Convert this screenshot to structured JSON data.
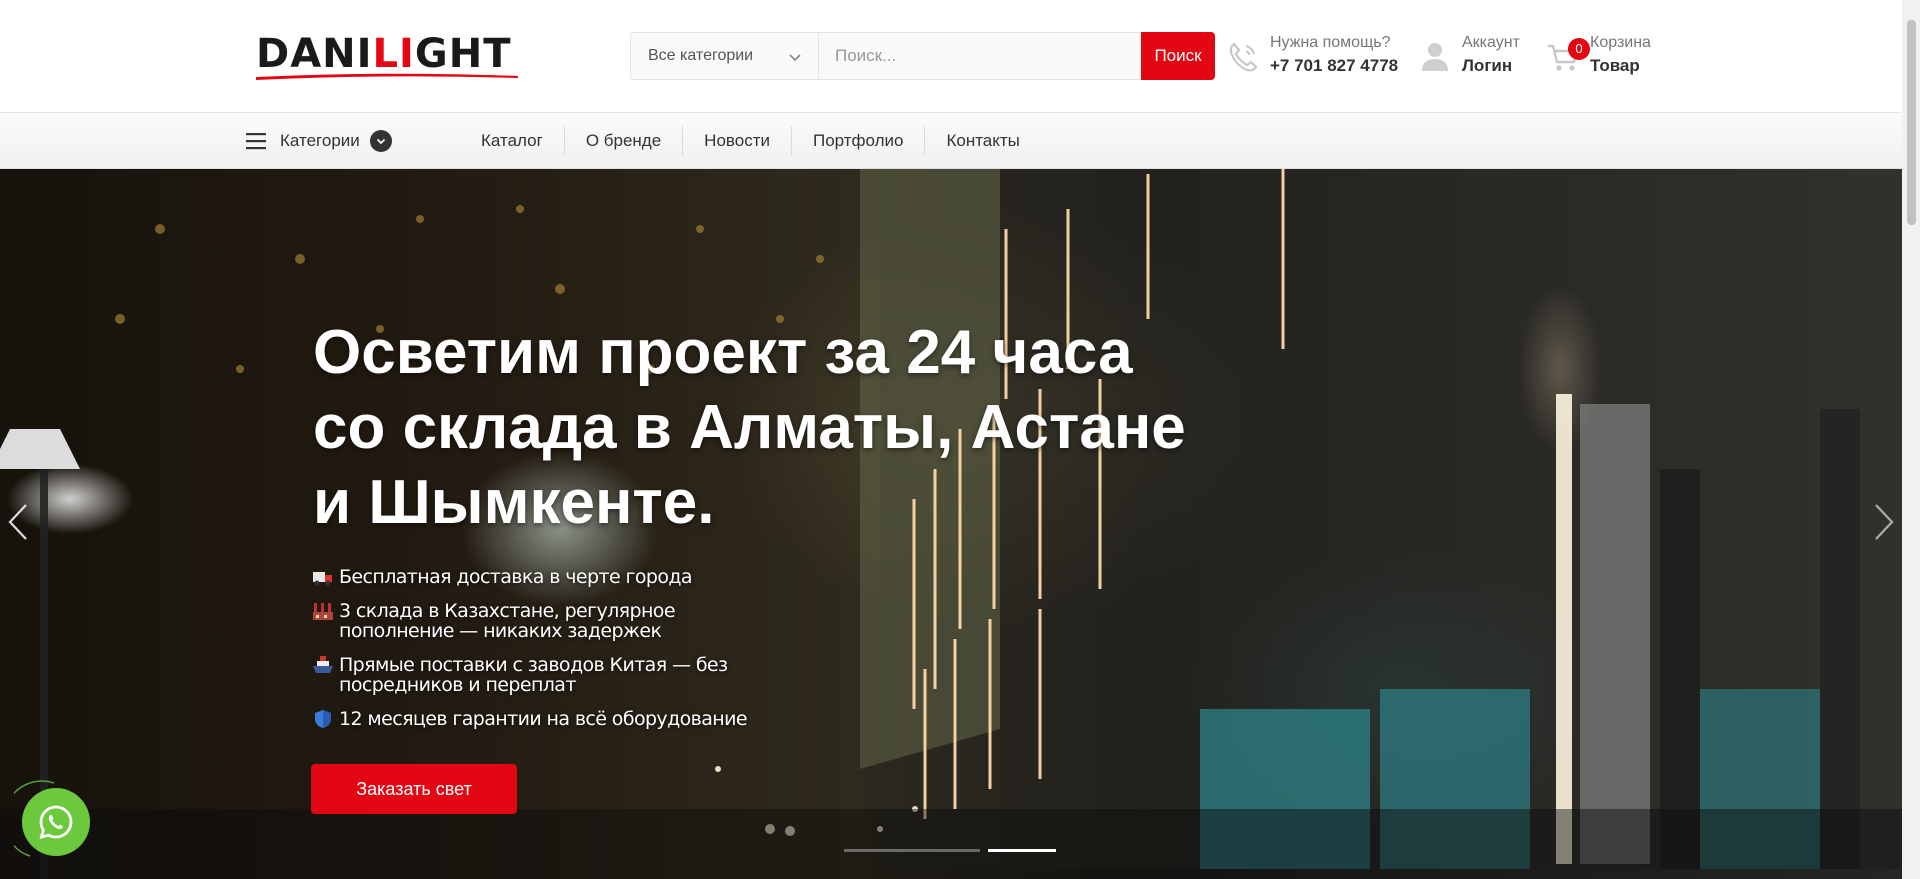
{
  "brand": {
    "logo_part1": "DANI",
    "logo_part2": "LI",
    "logo_part3": "GHT",
    "accent_color": "#e30613"
  },
  "search": {
    "category_label": "Все категории",
    "placeholder": "Поиск...",
    "button_label": "Поиск"
  },
  "help": {
    "label": "Нужна помощь?",
    "phone": "+7 701 827 4778",
    "icon": "phone-icon"
  },
  "account": {
    "label": "Аккаунт",
    "action": "Логин",
    "icon": "user-icon"
  },
  "cart": {
    "label": "Корзина",
    "action": "Товар",
    "count": "0",
    "icon": "cart-icon"
  },
  "nav": {
    "categories_label": "Категории",
    "links": [
      "Каталог",
      "О бренде",
      "Новости",
      "Портфолио",
      "Контакты"
    ]
  },
  "hero": {
    "title_line1": "Осветим проект за 24 часа",
    "title_line2": "со склада в Алматы, Астане",
    "title_line3": "и Шымкенте.",
    "features": [
      {
        "icon": "truck-icon",
        "text": "Бесплатная доставка в черте города"
      },
      {
        "icon": "factory-icon",
        "text": "3 склада в Казахстане, регулярное пополнение — никаких задержек"
      },
      {
        "icon": "ship-icon",
        "text": "Прямые поставки с заводов Китая — без посредников и переплат"
      },
      {
        "icon": "shield-icon",
        "text": "12 месяцев гарантии на всё оборудование"
      }
    ],
    "cta_label": "Заказать свет",
    "slides_total": 2,
    "slide_active": 2
  }
}
